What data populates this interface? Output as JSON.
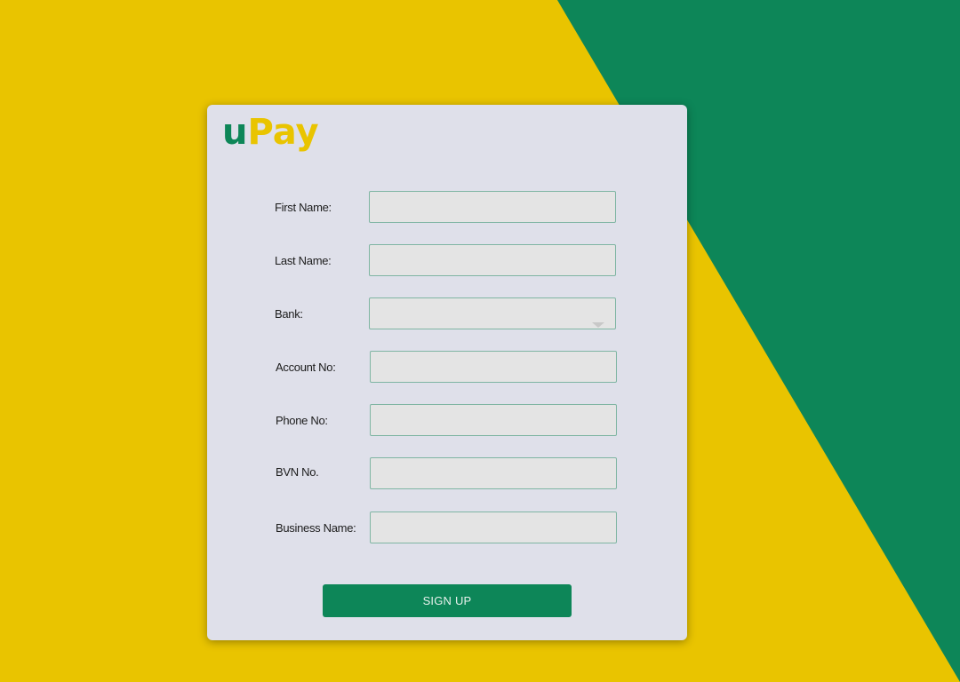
{
  "brand": {
    "logo_u": "u",
    "logo_p": "P",
    "logo_ay": "ay",
    "colors": {
      "yellow": "#e9c400",
      "green": "#0d8658",
      "card": "#dfe0ea"
    }
  },
  "form": {
    "fields": [
      {
        "label": "First Name:",
        "value": ""
      },
      {
        "label": "Last Name:",
        "value": ""
      },
      {
        "label": "Bank:",
        "value": "",
        "type": "select"
      },
      {
        "label": "Account No:",
        "value": ""
      },
      {
        "label": "Phone No:",
        "value": ""
      },
      {
        "label": "BVN No.",
        "value": ""
      },
      {
        "label": "Business Name:",
        "value": ""
      }
    ],
    "submit_label": "SIGN UP"
  }
}
